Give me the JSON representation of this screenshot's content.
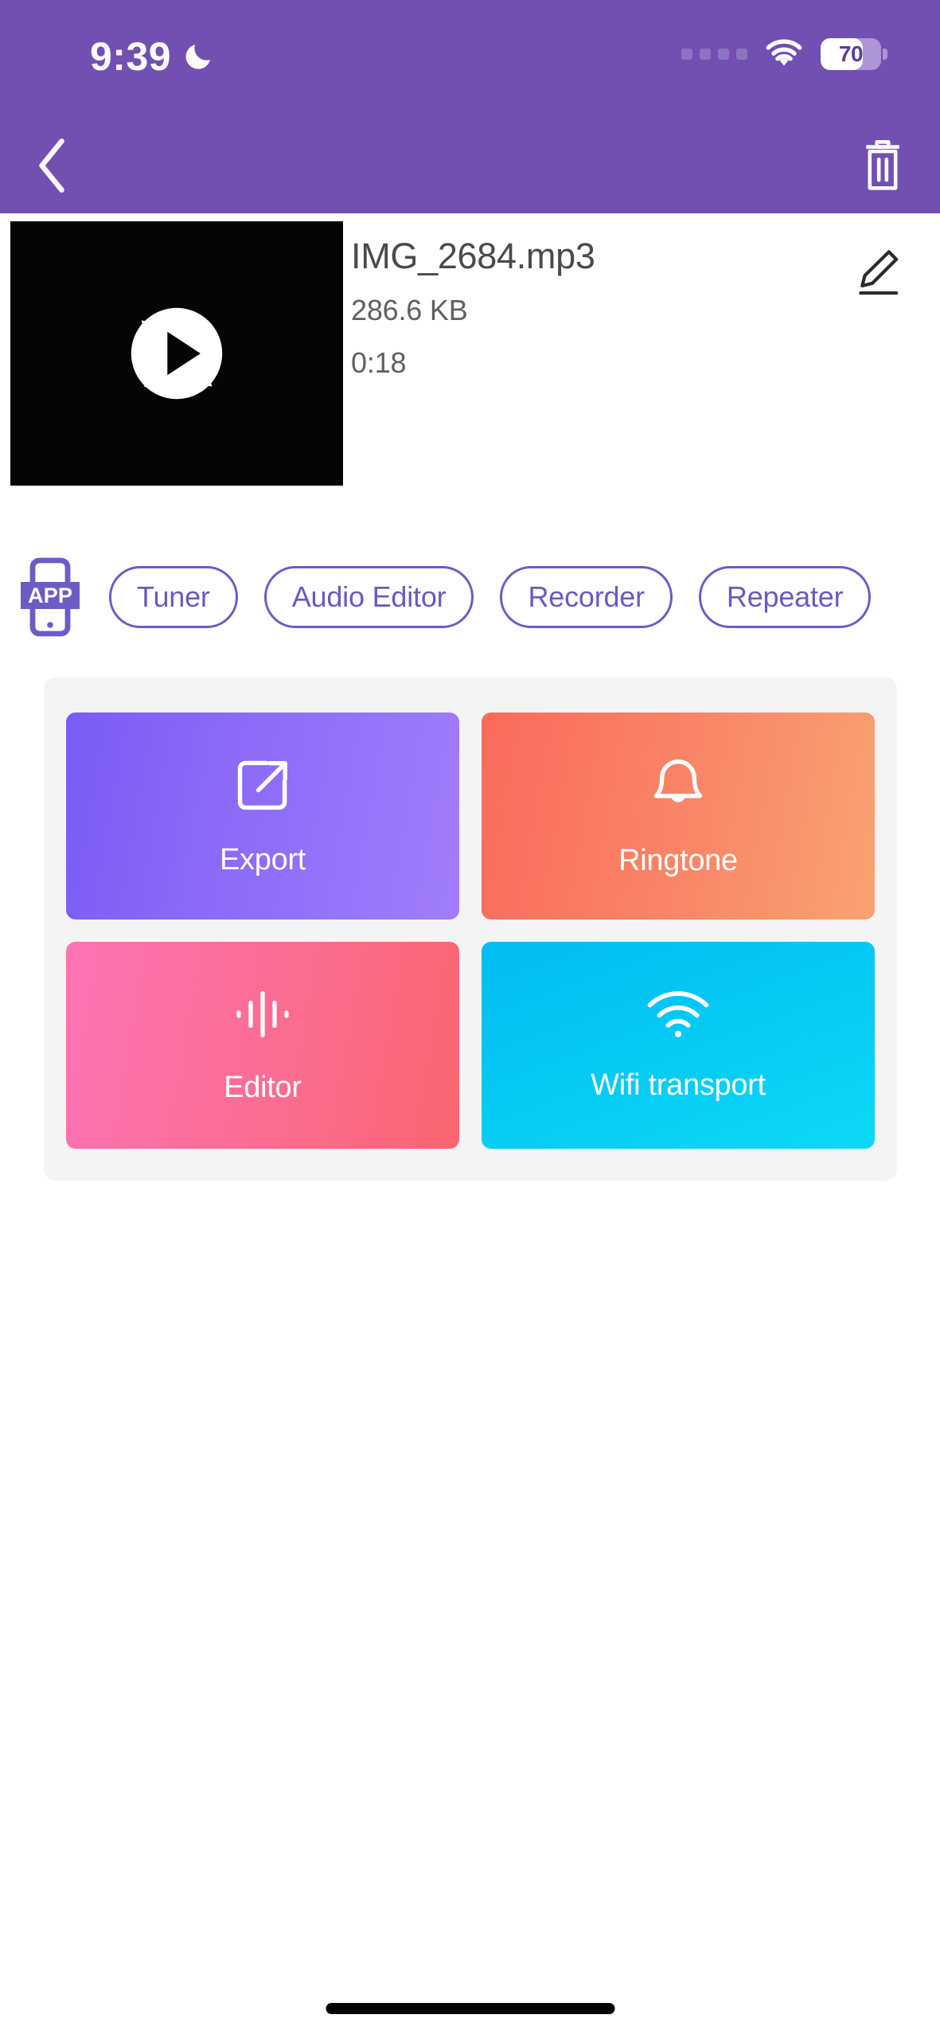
{
  "theme": {
    "header_purple": "#7150B2",
    "chip_purple": "#6A5AC0",
    "card_grey": "#F4F4F4",
    "text_dark": "#4A4A4A",
    "text_meta": "#606060"
  },
  "status_bar": {
    "time": "9:39",
    "dnd_icon": "moon-icon",
    "signal_icon": "signal-dots-icon",
    "wifi_icon": "wifi-icon",
    "battery_icon": "battery-icon",
    "battery_level": "70"
  },
  "nav_bar": {
    "back_icon": "chevron-left-icon",
    "delete_icon": "trash-icon"
  },
  "file": {
    "thumbnail_icon": "play-circle-icon",
    "name": "IMG_2684.mp3",
    "size": "286.6 KB",
    "duration": "0:18",
    "edit_icon": "pencil-icon"
  },
  "chips": {
    "app_icon": "app-phone-icon",
    "app_icon_text": "APP",
    "items": [
      {
        "label": "Tuner"
      },
      {
        "label": "Audio Editor"
      },
      {
        "label": "Recorder"
      },
      {
        "label": "Repeater"
      }
    ]
  },
  "actions": [
    {
      "label": "Export",
      "icon": "external-link-icon",
      "color_from": "#7A5CF5",
      "color_to": "#A07DFB"
    },
    {
      "label": "Ringtone",
      "icon": "bell-icon",
      "color_from": "#FA6A5C",
      "color_to": "#F9A271"
    },
    {
      "label": "Editor",
      "icon": "waveform-icon",
      "color_from": "#FB74B4",
      "color_to": "#FB6570"
    },
    {
      "label": "Wifi transport",
      "icon": "wifi-icon",
      "color_from": "#02BBF2",
      "color_to": "#0BD9F7"
    }
  ],
  "home_indicator": "home-indicator"
}
